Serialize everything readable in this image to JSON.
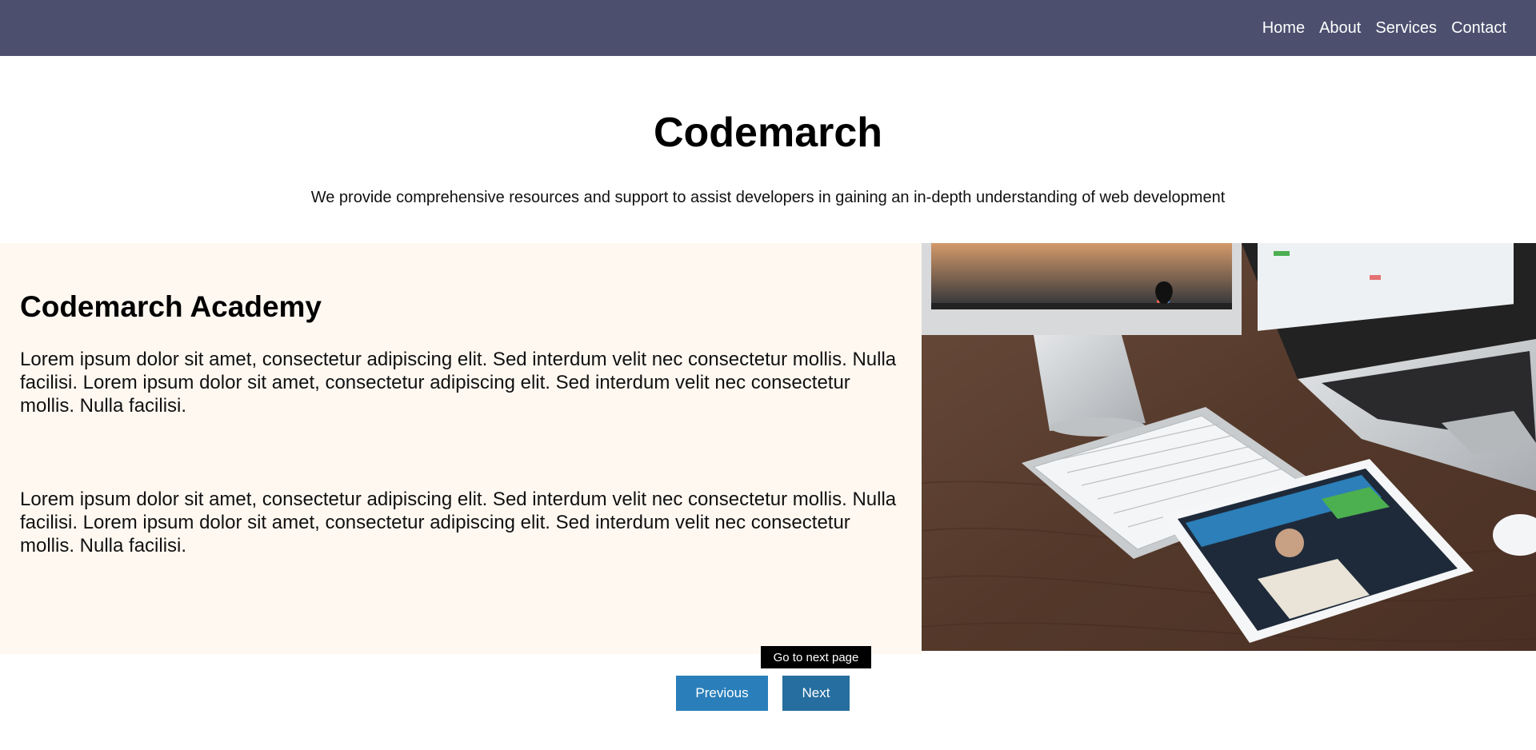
{
  "nav": {
    "items": [
      "Home",
      "About",
      "Services",
      "Contact"
    ]
  },
  "hero": {
    "title": "Codemarch",
    "subtitle": "We provide comprehensive resources and support to assist developers in gaining an in-depth understanding of web development"
  },
  "academy": {
    "heading": "Codemarch Academy",
    "paragraphs": [
      "Lorem ipsum dolor sit amet, consectetur adipiscing elit. Sed interdum velit nec consectetur mollis. Nulla facilisi. Lorem ipsum dolor sit amet, consectetur adipiscing elit. Sed interdum velit nec consectetur mollis. Nulla facilisi.",
      "Lorem ipsum dolor sit amet, consectetur adipiscing elit. Sed interdum velit nec consectetur mollis. Nulla facilisi. Lorem ipsum dolor sit amet, consectetur adipiscing elit. Sed interdum velit nec consectetur mollis. Nulla facilisi."
    ]
  },
  "pagination": {
    "previous_label": "Previous",
    "next_label": "Next",
    "tooltip": "Go to next page"
  },
  "colors": {
    "navbar": "#4c4f6e",
    "panel": "#fef8f1",
    "button": "#2a7fbb",
    "tooltip": "#000000"
  }
}
